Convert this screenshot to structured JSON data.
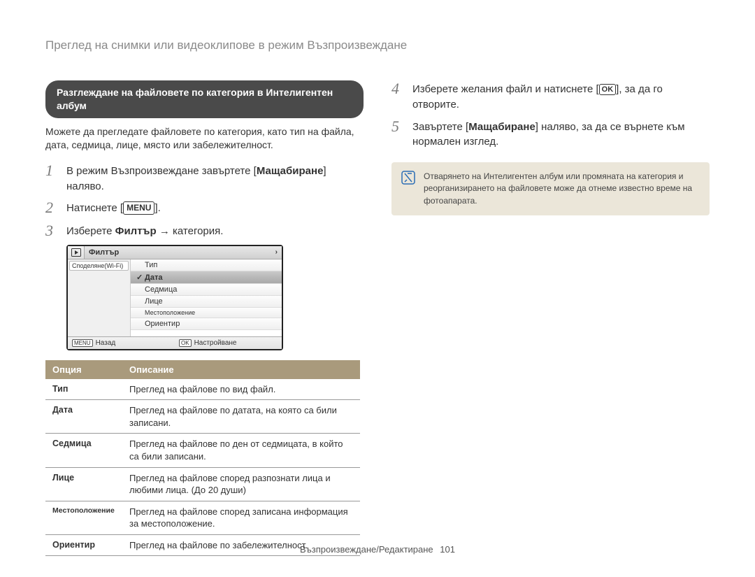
{
  "page_title": "Преглед на снимки или видеоклипове в режим Възпроизвеждане",
  "left": {
    "pill": "Разглеждане на файловете по категория в Интелигентен албум",
    "intro": "Можете да прегледате файловете по категория, като тип на файла, дата, седмица, лице, място или забележителност.",
    "steps": {
      "s1_a": "В режим Възпроизвеждане завъртете [",
      "s1_b": "Мащабиране",
      "s1_c": "] наляво.",
      "s2_a": "Натиснете [",
      "s2_menu": "MENU",
      "s2_b": "].",
      "s3_a": "Изберете ",
      "s3_b": "Филтър",
      "s3_c": " → категория."
    },
    "camera": {
      "tab": "Филтър",
      "left_item": "Споделяне(Wi-Fi)",
      "items": [
        "Тип",
        "Дата",
        "Седмица",
        "Лице",
        "Местоположение",
        "Ориентир"
      ],
      "selected_index": 1,
      "footer_back_key": "MENU",
      "footer_back": "Назад",
      "footer_set_key": "OK",
      "footer_set": "Настройване"
    },
    "table": {
      "head_opt": "Опция",
      "head_desc": "Описание",
      "rows": [
        {
          "name": "Тип",
          "desc": "Преглед на файлове по вид файл."
        },
        {
          "name": "Дата",
          "desc": "Преглед на файлове по датата, на която са били записани."
        },
        {
          "name": "Седмица",
          "desc": "Преглед на файлове по ден от седмицата, в който са били записани."
        },
        {
          "name": "Лице",
          "desc": "Преглед на файлове според разпознати лица и любими лица. (До 20 души)"
        },
        {
          "name": "Местоположение",
          "desc": "Преглед на файлове според записана информация за местоположение.",
          "small": true
        },
        {
          "name": "Ориентир",
          "desc": "Преглед на файлове по забележителност."
        }
      ]
    }
  },
  "right": {
    "s4_a": "Изберете желания файл и натиснете [",
    "s4_ok": "OK",
    "s4_b": "], за да го отворите.",
    "s5_a": "Завъртете [",
    "s5_b": "Мащабиране",
    "s5_c": "] наляво, за да се върнете към нормален изглед.",
    "note": "Отварянето на Интелигентен албум или промяната на категория и реорганизирането на файловете може да отнеме известно време на фотоапарата."
  },
  "footer": {
    "section": "Възпроизвеждане/Редактиране",
    "page": "101"
  }
}
